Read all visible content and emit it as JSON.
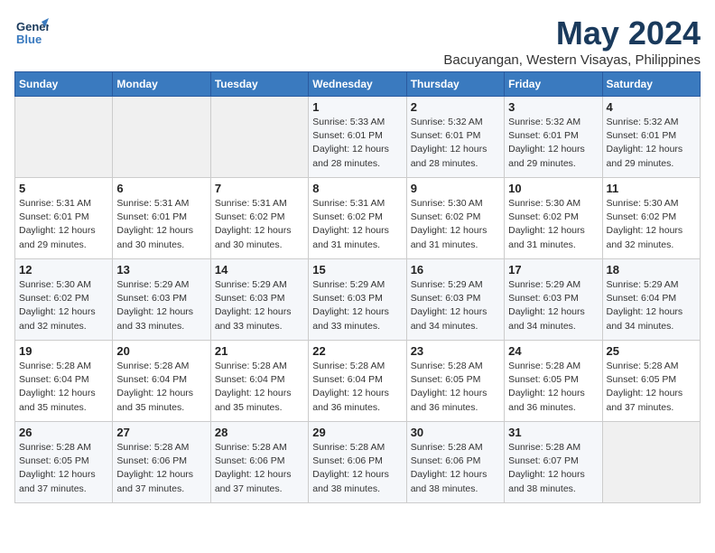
{
  "header": {
    "logo_general": "General",
    "logo_blue": "Blue",
    "title": "May 2024",
    "subtitle": "Bacuyangan, Western Visayas, Philippines"
  },
  "days_of_week": [
    "Sunday",
    "Monday",
    "Tuesday",
    "Wednesday",
    "Thursday",
    "Friday",
    "Saturday"
  ],
  "weeks": [
    {
      "cells": [
        {
          "day": "",
          "info": ""
        },
        {
          "day": "",
          "info": ""
        },
        {
          "day": "",
          "info": ""
        },
        {
          "day": "1",
          "info": "Sunrise: 5:33 AM\nSunset: 6:01 PM\nDaylight: 12 hours\nand 28 minutes."
        },
        {
          "day": "2",
          "info": "Sunrise: 5:32 AM\nSunset: 6:01 PM\nDaylight: 12 hours\nand 28 minutes."
        },
        {
          "day": "3",
          "info": "Sunrise: 5:32 AM\nSunset: 6:01 PM\nDaylight: 12 hours\nand 29 minutes."
        },
        {
          "day": "4",
          "info": "Sunrise: 5:32 AM\nSunset: 6:01 PM\nDaylight: 12 hours\nand 29 minutes."
        }
      ]
    },
    {
      "cells": [
        {
          "day": "5",
          "info": "Sunrise: 5:31 AM\nSunset: 6:01 PM\nDaylight: 12 hours\nand 29 minutes."
        },
        {
          "day": "6",
          "info": "Sunrise: 5:31 AM\nSunset: 6:01 PM\nDaylight: 12 hours\nand 30 minutes."
        },
        {
          "day": "7",
          "info": "Sunrise: 5:31 AM\nSunset: 6:02 PM\nDaylight: 12 hours\nand 30 minutes."
        },
        {
          "day": "8",
          "info": "Sunrise: 5:31 AM\nSunset: 6:02 PM\nDaylight: 12 hours\nand 31 minutes."
        },
        {
          "day": "9",
          "info": "Sunrise: 5:30 AM\nSunset: 6:02 PM\nDaylight: 12 hours\nand 31 minutes."
        },
        {
          "day": "10",
          "info": "Sunrise: 5:30 AM\nSunset: 6:02 PM\nDaylight: 12 hours\nand 31 minutes."
        },
        {
          "day": "11",
          "info": "Sunrise: 5:30 AM\nSunset: 6:02 PM\nDaylight: 12 hours\nand 32 minutes."
        }
      ]
    },
    {
      "cells": [
        {
          "day": "12",
          "info": "Sunrise: 5:30 AM\nSunset: 6:02 PM\nDaylight: 12 hours\nand 32 minutes."
        },
        {
          "day": "13",
          "info": "Sunrise: 5:29 AM\nSunset: 6:03 PM\nDaylight: 12 hours\nand 33 minutes."
        },
        {
          "day": "14",
          "info": "Sunrise: 5:29 AM\nSunset: 6:03 PM\nDaylight: 12 hours\nand 33 minutes."
        },
        {
          "day": "15",
          "info": "Sunrise: 5:29 AM\nSunset: 6:03 PM\nDaylight: 12 hours\nand 33 minutes."
        },
        {
          "day": "16",
          "info": "Sunrise: 5:29 AM\nSunset: 6:03 PM\nDaylight: 12 hours\nand 34 minutes."
        },
        {
          "day": "17",
          "info": "Sunrise: 5:29 AM\nSunset: 6:03 PM\nDaylight: 12 hours\nand 34 minutes."
        },
        {
          "day": "18",
          "info": "Sunrise: 5:29 AM\nSunset: 6:04 PM\nDaylight: 12 hours\nand 34 minutes."
        }
      ]
    },
    {
      "cells": [
        {
          "day": "19",
          "info": "Sunrise: 5:28 AM\nSunset: 6:04 PM\nDaylight: 12 hours\nand 35 minutes."
        },
        {
          "day": "20",
          "info": "Sunrise: 5:28 AM\nSunset: 6:04 PM\nDaylight: 12 hours\nand 35 minutes."
        },
        {
          "day": "21",
          "info": "Sunrise: 5:28 AM\nSunset: 6:04 PM\nDaylight: 12 hours\nand 35 minutes."
        },
        {
          "day": "22",
          "info": "Sunrise: 5:28 AM\nSunset: 6:04 PM\nDaylight: 12 hours\nand 36 minutes."
        },
        {
          "day": "23",
          "info": "Sunrise: 5:28 AM\nSunset: 6:05 PM\nDaylight: 12 hours\nand 36 minutes."
        },
        {
          "day": "24",
          "info": "Sunrise: 5:28 AM\nSunset: 6:05 PM\nDaylight: 12 hours\nand 36 minutes."
        },
        {
          "day": "25",
          "info": "Sunrise: 5:28 AM\nSunset: 6:05 PM\nDaylight: 12 hours\nand 37 minutes."
        }
      ]
    },
    {
      "cells": [
        {
          "day": "26",
          "info": "Sunrise: 5:28 AM\nSunset: 6:05 PM\nDaylight: 12 hours\nand 37 minutes."
        },
        {
          "day": "27",
          "info": "Sunrise: 5:28 AM\nSunset: 6:06 PM\nDaylight: 12 hours\nand 37 minutes."
        },
        {
          "day": "28",
          "info": "Sunrise: 5:28 AM\nSunset: 6:06 PM\nDaylight: 12 hours\nand 37 minutes."
        },
        {
          "day": "29",
          "info": "Sunrise: 5:28 AM\nSunset: 6:06 PM\nDaylight: 12 hours\nand 38 minutes."
        },
        {
          "day": "30",
          "info": "Sunrise: 5:28 AM\nSunset: 6:06 PM\nDaylight: 12 hours\nand 38 minutes."
        },
        {
          "day": "31",
          "info": "Sunrise: 5:28 AM\nSunset: 6:07 PM\nDaylight: 12 hours\nand 38 minutes."
        },
        {
          "day": "",
          "info": ""
        }
      ]
    }
  ]
}
